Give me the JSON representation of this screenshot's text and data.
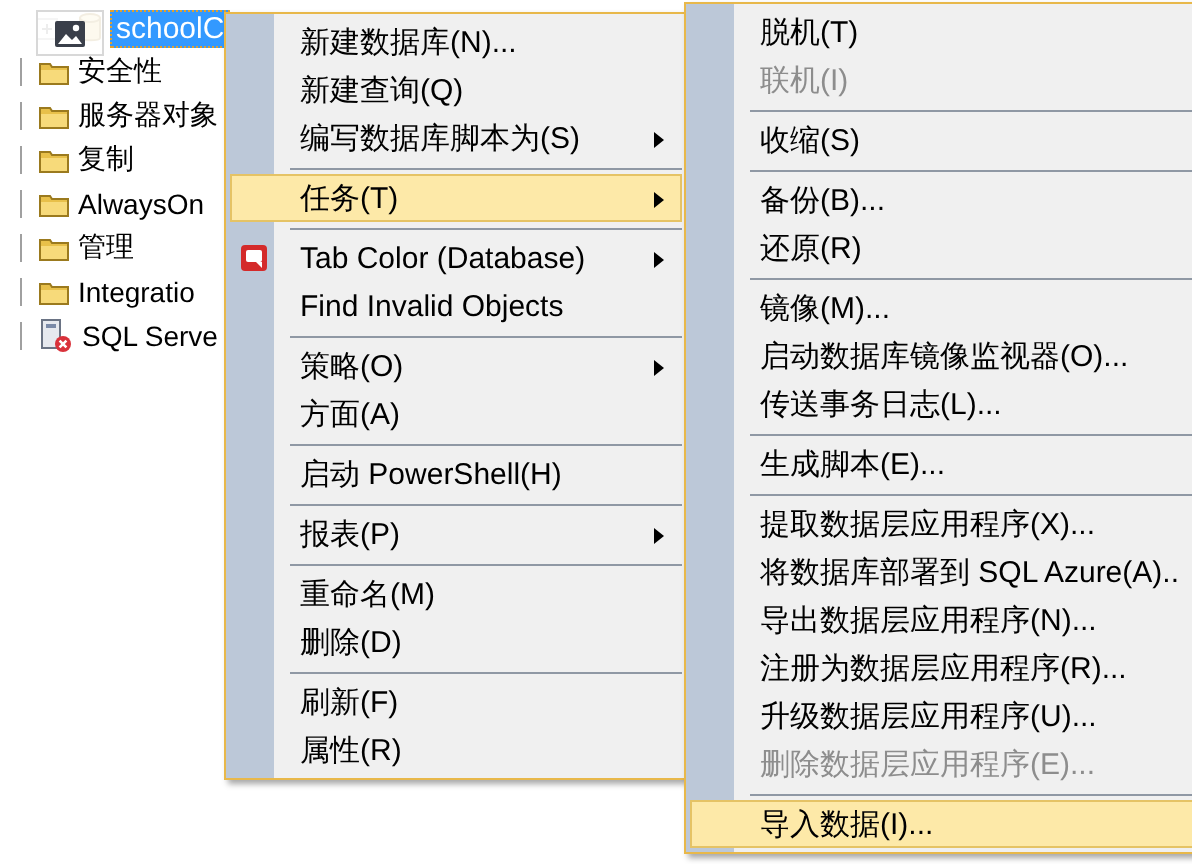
{
  "tree": {
    "root": {
      "label": "schoolC",
      "selected": true,
      "expanded": false
    },
    "items": [
      {
        "label": "安全性",
        "kind": "folder"
      },
      {
        "label": "服务器对象",
        "kind": "folder"
      },
      {
        "label": "复制",
        "kind": "folder"
      },
      {
        "label": "AlwaysOn",
        "kind": "folder"
      },
      {
        "label": "管理",
        "kind": "folder"
      },
      {
        "label": "Integratio",
        "kind": "folder"
      },
      {
        "label": "SQL Serve",
        "kind": "agent"
      }
    ]
  },
  "context_menu": {
    "items": [
      {
        "kind": "item",
        "label": "新建数据库(N)...",
        "submenu": false,
        "selected": false,
        "icon": false
      },
      {
        "kind": "item",
        "label": "新建查询(Q)",
        "submenu": false,
        "selected": false,
        "icon": false
      },
      {
        "kind": "item",
        "label": "编写数据库脚本为(S)",
        "submenu": true,
        "selected": false,
        "icon": false
      },
      {
        "kind": "separator"
      },
      {
        "kind": "item",
        "label": "任务(T)",
        "submenu": true,
        "selected": true,
        "icon": false
      },
      {
        "kind": "separator"
      },
      {
        "kind": "item",
        "label": "Tab Color (Database)",
        "submenu": true,
        "selected": false,
        "icon": true
      },
      {
        "kind": "item",
        "label": "Find Invalid Objects",
        "submenu": false,
        "selected": false,
        "icon": false
      },
      {
        "kind": "separator"
      },
      {
        "kind": "item",
        "label": "策略(O)",
        "submenu": true,
        "selected": false,
        "icon": false
      },
      {
        "kind": "item",
        "label": "方面(A)",
        "submenu": false,
        "selected": false,
        "icon": false
      },
      {
        "kind": "separator"
      },
      {
        "kind": "item",
        "label": "启动 PowerShell(H)",
        "submenu": false,
        "selected": false,
        "icon": false
      },
      {
        "kind": "separator"
      },
      {
        "kind": "item",
        "label": "报表(P)",
        "submenu": true,
        "selected": false,
        "icon": false
      },
      {
        "kind": "separator"
      },
      {
        "kind": "item",
        "label": "重命名(M)",
        "submenu": false,
        "selected": false,
        "icon": false
      },
      {
        "kind": "item",
        "label": "删除(D)",
        "submenu": false,
        "selected": false,
        "icon": false
      },
      {
        "kind": "separator"
      },
      {
        "kind": "item",
        "label": "刷新(F)",
        "submenu": false,
        "selected": false,
        "icon": false
      },
      {
        "kind": "item",
        "label": "属性(R)",
        "submenu": false,
        "selected": false,
        "icon": false
      }
    ]
  },
  "tasks_submenu": {
    "items": [
      {
        "kind": "item",
        "label": "脱机(T)",
        "disabled": false,
        "selected": false
      },
      {
        "kind": "item",
        "label": "联机(I)",
        "disabled": true,
        "selected": false
      },
      {
        "kind": "separator"
      },
      {
        "kind": "item",
        "label": "收缩(S)",
        "disabled": false,
        "selected": false
      },
      {
        "kind": "separator"
      },
      {
        "kind": "item",
        "label": "备份(B)...",
        "disabled": false,
        "selected": false
      },
      {
        "kind": "item",
        "label": "还原(R)",
        "disabled": false,
        "selected": false
      },
      {
        "kind": "separator"
      },
      {
        "kind": "item",
        "label": "镜像(M)...",
        "disabled": false,
        "selected": false
      },
      {
        "kind": "item",
        "label": "启动数据库镜像监视器(O)...",
        "disabled": false,
        "selected": false
      },
      {
        "kind": "item",
        "label": "传送事务日志(L)...",
        "disabled": false,
        "selected": false
      },
      {
        "kind": "separator"
      },
      {
        "kind": "item",
        "label": "生成脚本(E)...",
        "disabled": false,
        "selected": false
      },
      {
        "kind": "separator"
      },
      {
        "kind": "item",
        "label": "提取数据层应用程序(X)...",
        "disabled": false,
        "selected": false
      },
      {
        "kind": "item",
        "label": "将数据库部署到 SQL Azure(A)..",
        "disabled": false,
        "selected": false
      },
      {
        "kind": "item",
        "label": "导出数据层应用程序(N)...",
        "disabled": false,
        "selected": false
      },
      {
        "kind": "item",
        "label": "注册为数据层应用程序(R)...",
        "disabled": false,
        "selected": false
      },
      {
        "kind": "item",
        "label": "升级数据层应用程序(U)...",
        "disabled": false,
        "selected": false
      },
      {
        "kind": "item",
        "label": "删除数据层应用程序(E)...",
        "disabled": true,
        "selected": false
      },
      {
        "kind": "separator"
      },
      {
        "kind": "item",
        "label": "导入数据(I)...",
        "disabled": false,
        "selected": true
      }
    ]
  }
}
